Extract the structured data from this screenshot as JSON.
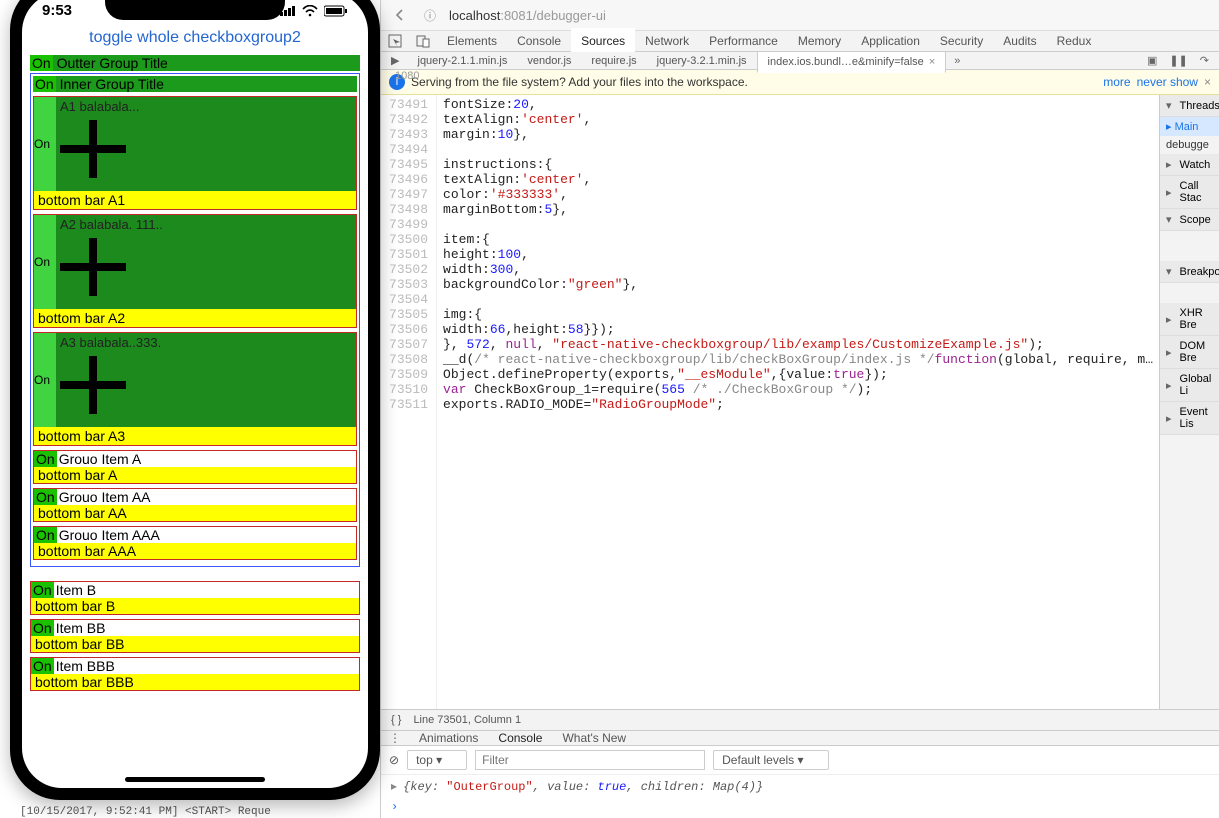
{
  "phone": {
    "time": "9:53",
    "link": "toggle whole checkboxgroup2",
    "outer_title": "Outter Group Title",
    "inner_title": "Inner Group Title",
    "on_label": "On",
    "cards": [
      {
        "title": "A1 balabala...",
        "bar": "bottom bar A1"
      },
      {
        "title": "A2 balabala. 111..",
        "bar": "bottom bar A2"
      },
      {
        "title": "A3 balabala..333.",
        "bar": "bottom bar A3"
      }
    ],
    "slims": [
      {
        "title": "Grouo Item A",
        "bar": "bottom bar A"
      },
      {
        "title": "Grouo Item AA",
        "bar": "bottom bar AA"
      },
      {
        "title": "Grouo Item AAA",
        "bar": "bottom bar AAA"
      }
    ],
    "outer_items": [
      {
        "title": "Item B",
        "bar": "bottom bar B"
      },
      {
        "title": "Item BB",
        "bar": "bottom bar BB"
      },
      {
        "title": "Item BBB",
        "bar": "bottom bar BBB"
      }
    ]
  },
  "browser": {
    "url_host": "localhost",
    "url_port": ":8081",
    "url_path": "/debugger-ui"
  },
  "devtools": {
    "tabs": [
      "Elements",
      "Console",
      "Sources",
      "Network",
      "Performance",
      "Memory",
      "Application",
      "Security",
      "Audits",
      "Redux"
    ],
    "active_tab": "Sources",
    "files": [
      "jquery-2.1.1.min.js",
      "vendor.js",
      "require.js",
      "jquery-3.2.1.min.js",
      "index.ios.bundl…e&minify=false"
    ],
    "active_file_index": 4,
    "info": "Serving from the file system? Add your files into the workspace.",
    "info_more": "more",
    "info_never": "never show",
    "gutter_start": 73491,
    "code_lines": [
      [
        [
          "",
          "fontSize:"
        ],
        [
          "num",
          "20"
        ],
        [
          "",
          ","
        ]
      ],
      [
        [
          "",
          "textAlign:"
        ],
        [
          "str",
          "'center'"
        ],
        [
          "",
          ","
        ]
      ],
      [
        [
          "",
          "margin:"
        ],
        [
          "num",
          "10"
        ],
        [
          "",
          "},"
        ]
      ],
      [
        [
          "",
          ""
        ]
      ],
      [
        [
          "",
          "instructions:{"
        ]
      ],
      [
        [
          "",
          "textAlign:"
        ],
        [
          "str",
          "'center'"
        ],
        [
          "",
          ","
        ]
      ],
      [
        [
          "",
          "color:"
        ],
        [
          "str",
          "'#333333'"
        ],
        [
          "",
          ","
        ]
      ],
      [
        [
          "",
          "marginBottom:"
        ],
        [
          "num",
          "5"
        ],
        [
          "",
          "},"
        ]
      ],
      [
        [
          "",
          ""
        ]
      ],
      [
        [
          "",
          "item:{"
        ]
      ],
      [
        [
          "",
          "height:"
        ],
        [
          "num",
          "100"
        ],
        [
          "",
          ","
        ]
      ],
      [
        [
          "",
          "width:"
        ],
        [
          "num",
          "300"
        ],
        [
          "",
          ","
        ]
      ],
      [
        [
          "",
          "backgroundColor:"
        ],
        [
          "str",
          "\"green\""
        ],
        [
          "",
          "},"
        ]
      ],
      [
        [
          "",
          ""
        ]
      ],
      [
        [
          "",
          "img:{"
        ]
      ],
      [
        [
          "",
          "width:"
        ],
        [
          "num",
          "66"
        ],
        [
          "",
          ",height:"
        ],
        [
          "num",
          "58"
        ],
        [
          "",
          "}});"
        ]
      ],
      [
        [
          "",
          "}, "
        ],
        [
          "num",
          "572"
        ],
        [
          "",
          ", "
        ],
        [
          "kw",
          "null"
        ],
        [
          "",
          ", "
        ],
        [
          "str",
          "\"react-native-checkboxgroup/lib/examples/CustomizeExample.js\""
        ],
        [
          "",
          ");"
        ]
      ],
      [
        [
          "",
          "__d("
        ],
        [
          "grey",
          "/* react-native-checkboxgroup/lib/checkBoxGroup/index.js */"
        ],
        [
          "kw",
          "function"
        ],
        [
          "",
          "(global, require, m…"
        ]
      ],
      [
        [
          "",
          "Object.defineProperty(exports,"
        ],
        [
          "str",
          "\"__esModule\""
        ],
        [
          "",
          ",{value:"
        ],
        [
          "kw",
          "true"
        ],
        [
          "",
          "});"
        ]
      ],
      [
        [
          "kw",
          "var"
        ],
        [
          "",
          " CheckBoxGroup_1=require("
        ],
        [
          "num",
          "565"
        ],
        [
          "",
          " "
        ],
        [
          "grey",
          "/* ./CheckBoxGroup */"
        ],
        [
          "",
          ");"
        ]
      ],
      [
        [
          "",
          "exports.RADIO_MODE="
        ],
        [
          "str",
          "\"RadioGroupMode\""
        ],
        [
          "",
          ";"
        ]
      ]
    ],
    "status_line": "Line 73501, Column 1",
    "drawer_tabs": [
      "Animations",
      "Console",
      "What's New"
    ],
    "drawer_active": 1,
    "console_context": "top",
    "console_filter_ph": "Filter",
    "console_levels": "Default levels",
    "console_obj": "{key: \"OuterGroup\", value: true, children: Map(4)}",
    "sidebar": {
      "threads": "Threads",
      "main": "Main",
      "debugge": "debugge",
      "watch": "Watch",
      "callstack": "Call Stac",
      "scope": "Scope",
      "breakpo": "Breakpo",
      "xhr": "XHR Bre",
      "dom": "DOM Bre",
      "global": "Global Li",
      "event": "Event Lis"
    }
  },
  "bg": {
    "res": "1080",
    "terminal": "[10/15/2017, 9:52:41 PM] <START> Reque"
  }
}
